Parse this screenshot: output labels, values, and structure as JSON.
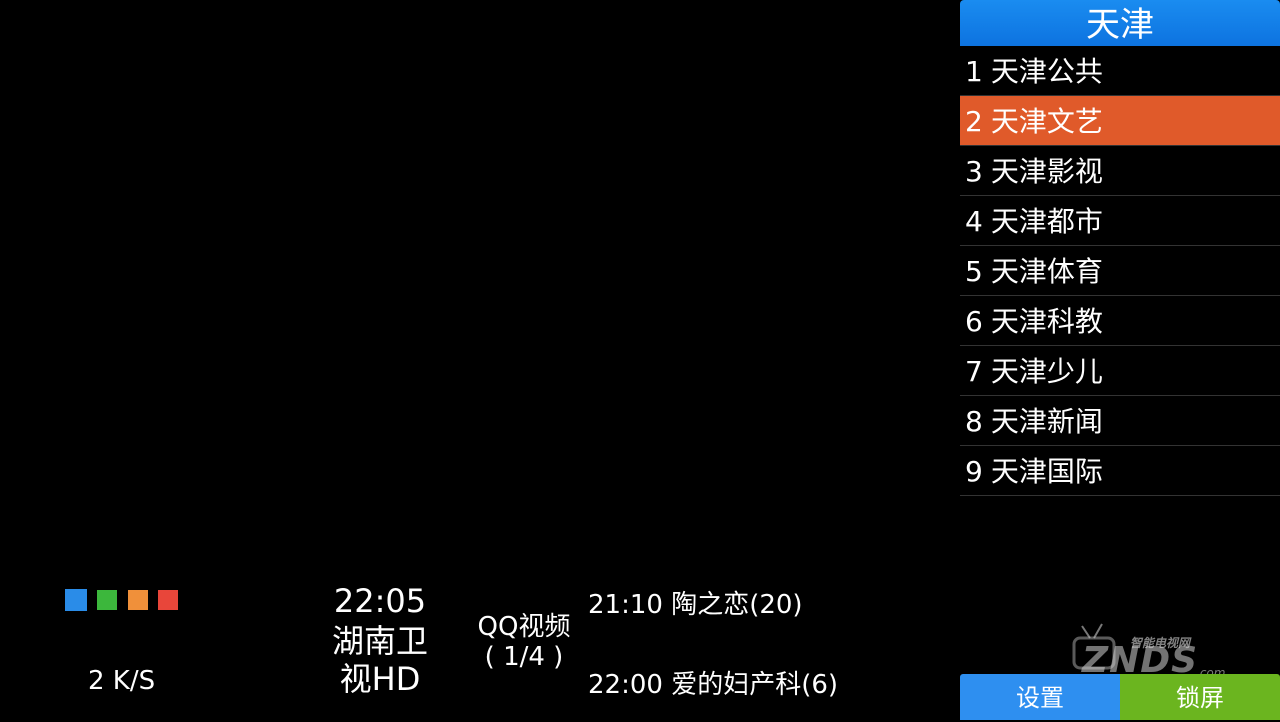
{
  "channel_panel": {
    "group_title": "天津",
    "channels": [
      {
        "num": "1",
        "name": "天津公共"
      },
      {
        "num": "2",
        "name": "天津文艺"
      },
      {
        "num": "3",
        "name": "天津影视"
      },
      {
        "num": "4",
        "name": "天津都市"
      },
      {
        "num": "5",
        "name": "天津体育"
      },
      {
        "num": "6",
        "name": "天津科教"
      },
      {
        "num": "7",
        "name": "天津少儿"
      },
      {
        "num": "8",
        "name": "天津新闻"
      },
      {
        "num": "9",
        "name": "天津国际"
      }
    ],
    "selected_index": 1,
    "selected_color": "#e05a2a"
  },
  "buttons": {
    "settings_label": "设置",
    "lock_label": "锁屏"
  },
  "watermark": {
    "top_text": "智能电视网",
    "main_text": "ZNDS",
    "suffix_text": ".com"
  },
  "info_bar": {
    "signal_colors": [
      "#2a8ce8",
      "#3cb73c",
      "#f0903a",
      "#e8463a"
    ],
    "speed": "2 K/S",
    "time": "22:05",
    "channel_name_line1": "湖南卫",
    "channel_name_line2": "视HD",
    "source_name": "QQ视频",
    "source_index": "( 1/4 )",
    "epg_now": "21:10 陶之恋(20)",
    "epg_next": "22:00 爱的妇产科(6)"
  }
}
